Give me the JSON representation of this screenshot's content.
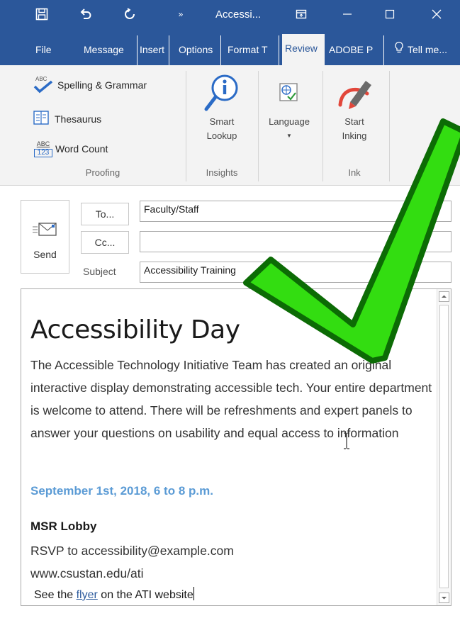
{
  "window": {
    "title": "Accessi...",
    "icons": [
      "save-icon",
      "undo-icon",
      "redo-icon",
      "more-icon",
      "ribbon-display-icon",
      "minimize-icon",
      "maximize-icon",
      "close-icon"
    ]
  },
  "tabs": {
    "file": "File",
    "message": "Message",
    "insert": "Insert",
    "options": "Options",
    "format": "Format T",
    "review": "Review",
    "adobe": "ADOBE P",
    "tell_me": "Tell me..."
  },
  "ribbon": {
    "spelling": "Spelling & Grammar",
    "thesaurus": "Thesaurus",
    "word_count": "Word Count",
    "proofing": "Proofing",
    "smart_lookup_1": "Smart",
    "smart_lookup_2": "Lookup",
    "insights": "Insights",
    "language": "Language",
    "start_inking_1": "Start",
    "start_inking_2": "Inking",
    "ink": "Ink",
    "abc": "ABC",
    "abc_num": "123"
  },
  "compose": {
    "send": "Send",
    "to_button": "To...",
    "cc_button": "Cc...",
    "subject_label": "Subject",
    "to_value": "Faculty/Staff",
    "cc_value": "",
    "subject_value": "Accessibility Training"
  },
  "message": {
    "title": "Accessibility Day",
    "paragraph": "The Accessible Technology Initiative Team has created an original interactive display demonstrating accessible tech. Your entire department is welcome to attend. There will be refreshments and expert panels to answer your questions on usability and equal access to information",
    "date": "September 1st, 2018, 6 to 8 p.m.",
    "location": "MSR Lobby",
    "rsvp": "RSVP to accessibility@example.com",
    "website": "www.csustan.edu/ati",
    "flyer_pre": "See the ",
    "flyer_link": "flyer",
    "flyer_post": " on the ATI website"
  },
  "colors": {
    "titlebar": "#2b579a",
    "date_accent": "#5b9bd5",
    "checkmark_fill": "#33dd11",
    "checkmark_stroke": "#0c6b05"
  }
}
